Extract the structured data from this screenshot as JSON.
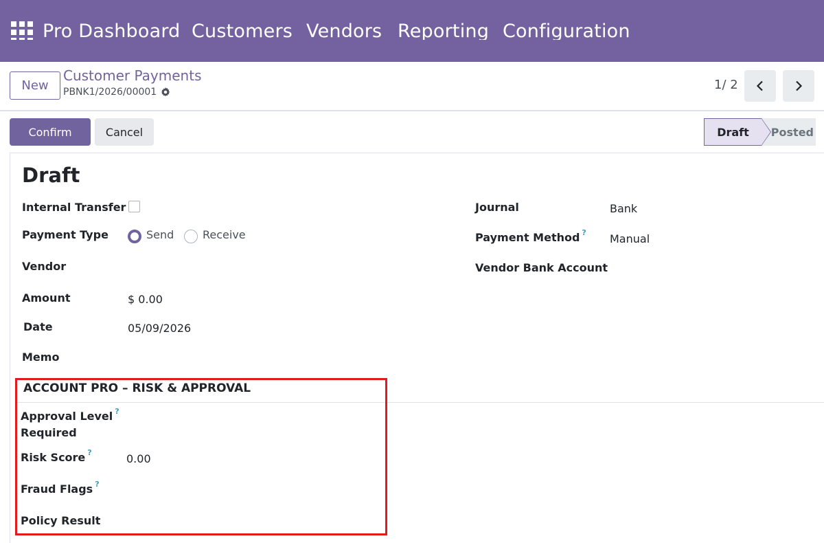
{
  "navbar": {
    "menu": [
      "Pro Dashboard",
      "Customers",
      "Vendors",
      "Reporting",
      "Configuration"
    ]
  },
  "control_panel": {
    "new_label": "New",
    "breadcrumb": "Customer Payments",
    "record_ref": "PBNK1/2026/00001",
    "pager": "1/ 2"
  },
  "actions": {
    "confirm": "Confirm",
    "cancel": "Cancel"
  },
  "statusbar": {
    "stages": [
      "Draft",
      "Posted"
    ],
    "current": "Draft"
  },
  "form": {
    "title": "Draft",
    "left": {
      "internal_transfer_label": "Internal Transfer",
      "internal_transfer_checked": false,
      "payment_type_label": "Payment Type",
      "payment_type_options": [
        "Send",
        "Receive"
      ],
      "payment_type_selected": "Send",
      "vendor_label": "Vendor",
      "amount_label": "Amount",
      "amount_value": "$ 0.00",
      "date_label": "Date",
      "date_value": "05/09/2026",
      "memo_label": "Memo"
    },
    "right": {
      "journal_label": "Journal",
      "journal_value": "Bank",
      "payment_method_label": "Payment Method",
      "payment_method_value": "Manual",
      "vendor_bank_label": "Vendor Bank Account"
    },
    "risk_section": {
      "title": "ACCOUNT PRO – RISK & APPROVAL",
      "approval_level_label_1": "Approval Level",
      "approval_level_label_2": "Required",
      "risk_score_label": "Risk Score",
      "risk_score_value": "0.00",
      "fraud_flags_label": "Fraud Flags",
      "policy_result_label": "Policy Result"
    },
    "help_mark": "?"
  },
  "colors": {
    "brand": "#7462a0",
    "primary": "#71639e",
    "help": "#3d9fbb",
    "highlight": "#e01b1b"
  }
}
